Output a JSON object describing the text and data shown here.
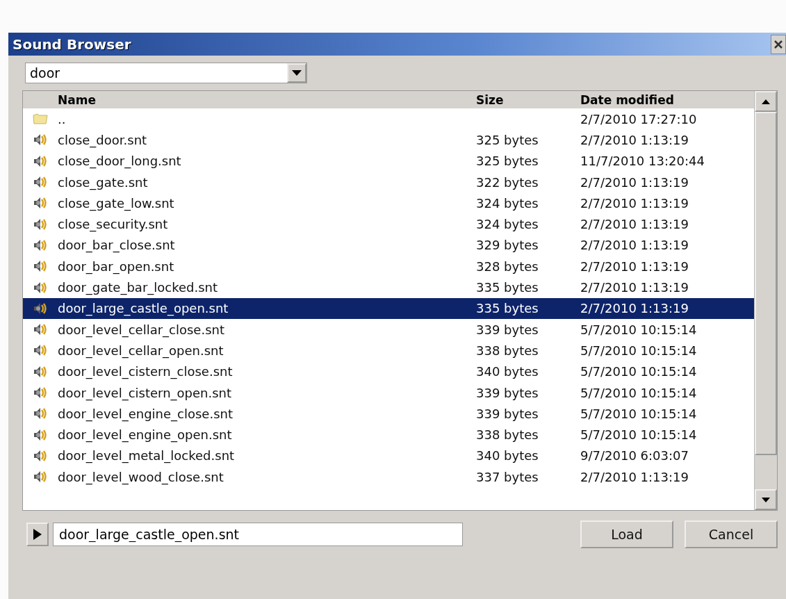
{
  "window": {
    "title": "Sound Browser"
  },
  "filter": {
    "value": "door"
  },
  "table": {
    "columns": [
      "Name",
      "Size",
      "Date modified"
    ],
    "rows": [
      {
        "kind": "folder",
        "name": "..",
        "size": "",
        "date": "2/7/2010 17:27:10",
        "selected": false
      },
      {
        "kind": "sound",
        "name": "close_door.snt",
        "size": "325 bytes",
        "date": "2/7/2010 1:13:19",
        "selected": false
      },
      {
        "kind": "sound",
        "name": "close_door_long.snt",
        "size": "325 bytes",
        "date": "11/7/2010 13:20:44",
        "selected": false
      },
      {
        "kind": "sound",
        "name": "close_gate.snt",
        "size": "322 bytes",
        "date": "2/7/2010 1:13:19",
        "selected": false
      },
      {
        "kind": "sound",
        "name": "close_gate_low.snt",
        "size": "324 bytes",
        "date": "2/7/2010 1:13:19",
        "selected": false
      },
      {
        "kind": "sound",
        "name": "close_security.snt",
        "size": "324 bytes",
        "date": "2/7/2010 1:13:19",
        "selected": false
      },
      {
        "kind": "sound",
        "name": "door_bar_close.snt",
        "size": "329 bytes",
        "date": "2/7/2010 1:13:19",
        "selected": false
      },
      {
        "kind": "sound",
        "name": "door_bar_open.snt",
        "size": "328 bytes",
        "date": "2/7/2010 1:13:19",
        "selected": false
      },
      {
        "kind": "sound",
        "name": "door_gate_bar_locked.snt",
        "size": "335 bytes",
        "date": "2/7/2010 1:13:19",
        "selected": false
      },
      {
        "kind": "sound",
        "name": "door_large_castle_open.snt",
        "size": "335 bytes",
        "date": "2/7/2010 1:13:19",
        "selected": true
      },
      {
        "kind": "sound",
        "name": "door_level_cellar_close.snt",
        "size": "339 bytes",
        "date": "5/7/2010 10:15:14",
        "selected": false
      },
      {
        "kind": "sound",
        "name": "door_level_cellar_open.snt",
        "size": "338 bytes",
        "date": "5/7/2010 10:15:14",
        "selected": false
      },
      {
        "kind": "sound",
        "name": "door_level_cistern_close.snt",
        "size": "340 bytes",
        "date": "5/7/2010 10:15:14",
        "selected": false
      },
      {
        "kind": "sound",
        "name": "door_level_cistern_open.snt",
        "size": "339 bytes",
        "date": "5/7/2010 10:15:14",
        "selected": false
      },
      {
        "kind": "sound",
        "name": "door_level_engine_close.snt",
        "size": "339 bytes",
        "date": "5/7/2010 10:15:14",
        "selected": false
      },
      {
        "kind": "sound",
        "name": "door_level_engine_open.snt",
        "size": "338 bytes",
        "date": "5/7/2010 10:15:14",
        "selected": false
      },
      {
        "kind": "sound",
        "name": "door_level_metal_locked.snt",
        "size": "340 bytes",
        "date": "9/7/2010 6:03:07",
        "selected": false
      },
      {
        "kind": "sound",
        "name": "door_level_wood_close.snt",
        "size": "337 bytes",
        "date": "2/7/2010 1:13:19",
        "selected": false
      }
    ]
  },
  "file_field": {
    "value": "door_large_castle_open.snt"
  },
  "buttons": [
    "Load",
    "Cancel"
  ]
}
